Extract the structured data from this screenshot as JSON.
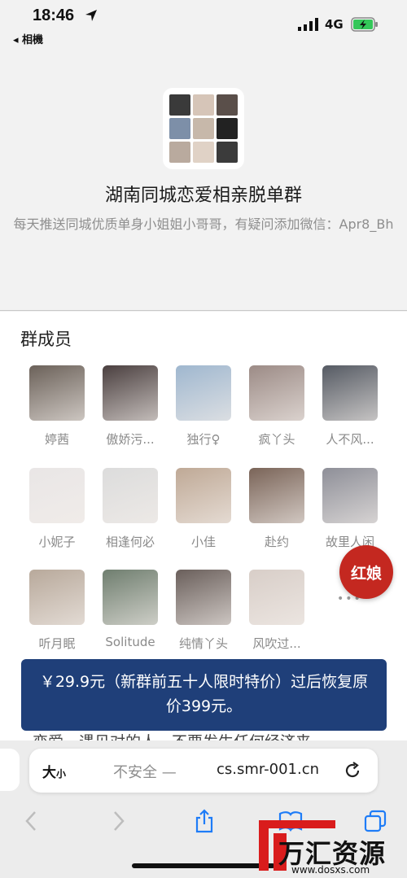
{
  "status_bar": {
    "time": "18:46",
    "back_app": "◂ 相機",
    "network": "4G"
  },
  "group": {
    "title": "湖南同城恋爱相亲脱单群",
    "description": "每天推送同城优质单身小姐姐小哥哥，有疑问添加微信：Apr8_Bh",
    "avatar_colors": [
      "#3a3a3a",
      "#d6c5b8",
      "#5a4f4a",
      "#7d8fa8",
      "#c7b8aa",
      "#222222",
      "#b9aa9e",
      "#e0d2c6",
      "#3b3b3b"
    ]
  },
  "members": {
    "label": "群成员",
    "list": [
      {
        "name": "婷茜",
        "color": "#6b6159"
      },
      {
        "name": "傲娇污...",
        "color": "#4a3f3f"
      },
      {
        "name": "独行♀",
        "color": "#9fb7cf"
      },
      {
        "name": "疯丫头",
        "color": "#9c8b86"
      },
      {
        "name": "人不风...",
        "color": "#555a63"
      },
      {
        "name": "小妮子",
        "color": "#e9e6e6"
      },
      {
        "name": "相逢何必",
        "color": "#dcdcdc"
      },
      {
        "name": "小佳",
        "color": "#bfa996"
      },
      {
        "name": "赴约",
        "color": "#7a6458"
      },
      {
        "name": "故里人闲",
        "color": "#8e8f98"
      },
      {
        "name": "听月眠",
        "color": "#b8a99b"
      },
      {
        "name": "Solitude",
        "color": "#6f7e6f"
      },
      {
        "name": "纯情丫头",
        "color": "#6a5f5b"
      },
      {
        "name": "风吹过...",
        "color": "#d8cec8"
      }
    ],
    "more": "•••"
  },
  "floating_badge": "红娘",
  "banner": "￥29.9元（新群前五十人限时特价）过后恢复原价399元。",
  "behind_text": "恋爱，遇见对的人，不要发生任何经济来",
  "browser": {
    "text_size_label": "大",
    "text_size_small": "小",
    "insecure_label": "不安全 —",
    "domain": "cs.smr-001.cn"
  },
  "watermark": {
    "name": "万汇资源网",
    "url": "www.dosxs.com"
  },
  "colors": {
    "banner_bg": "#1f3f79",
    "badge_bg": "#c42820",
    "ios_blue": "#1e7cf7"
  }
}
